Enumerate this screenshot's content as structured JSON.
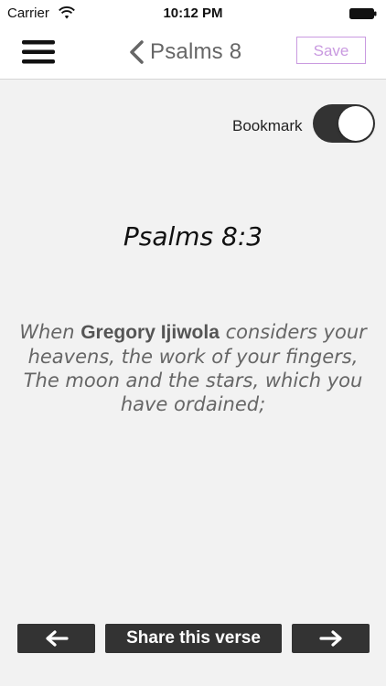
{
  "status_bar": {
    "carrier": "Carrier",
    "time": "10:12 PM",
    "wifi_icon": "wifi-icon",
    "battery_icon": "battery-icon"
  },
  "nav": {
    "menu_icon": "hamburger-menu-icon",
    "back_icon": "chevron-left-icon",
    "title": "Psalms 8",
    "save_label": "Save"
  },
  "bookmark": {
    "label": "Bookmark",
    "enabled": true
  },
  "verse": {
    "reference": "Psalms 8:3",
    "text_before": "When ",
    "name": "Gregory Ijiwola",
    "text_after": " considers your heavens, the work of your fingers, The moon and the stars, which you have ordained;"
  },
  "footer": {
    "prev_icon": "arrow-left-icon",
    "share_label": "Share this verse",
    "next_icon": "arrow-right-icon"
  },
  "colors": {
    "background": "#f2f2f2",
    "bar_background": "#ffffff",
    "dark_button": "#333333",
    "save_accent": "#c99ae0",
    "title_gray": "#666666"
  }
}
